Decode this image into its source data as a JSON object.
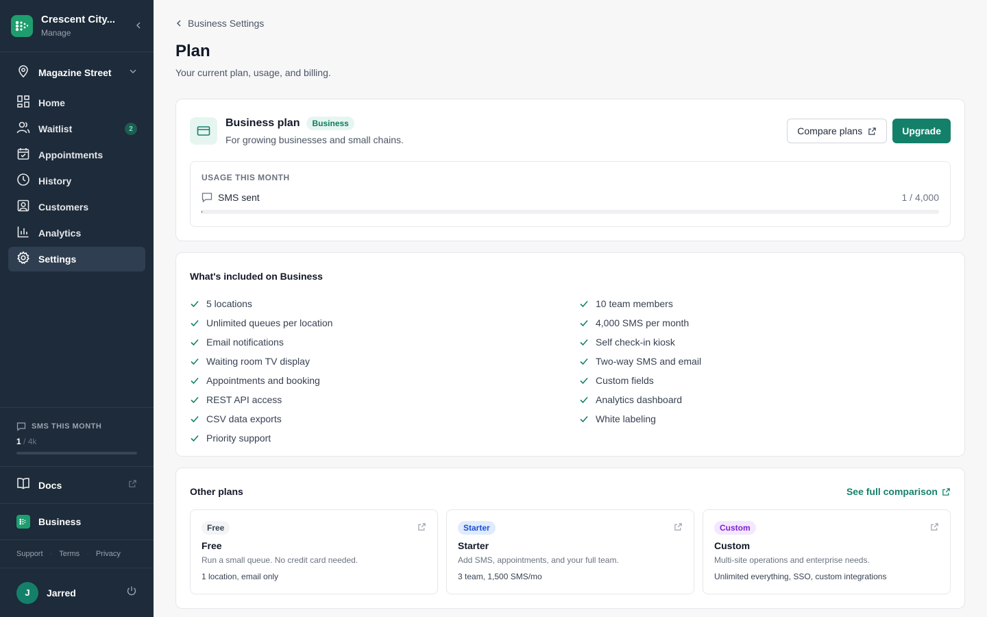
{
  "sidebar": {
    "org_name": "Crescent City...",
    "org_sub": "Manage",
    "location": "Magazine Street",
    "nav": [
      {
        "label": "Home",
        "icon": "grid-icon"
      },
      {
        "label": "Waitlist",
        "icon": "users-icon",
        "badge": "2"
      },
      {
        "label": "Appointments",
        "icon": "calendar-icon"
      },
      {
        "label": "History",
        "icon": "clock-icon"
      },
      {
        "label": "Customers",
        "icon": "contact-icon"
      },
      {
        "label": "Analytics",
        "icon": "bar-chart-icon"
      },
      {
        "label": "Settings",
        "icon": "gear-icon",
        "active": true
      }
    ],
    "sms": {
      "title": "SMS THIS MONTH",
      "used": "1",
      "limit": " / 4k",
      "fraction": 0.00025
    },
    "docs": "Docs",
    "plan": "Business",
    "links": [
      "Support",
      "Terms",
      "Privacy"
    ],
    "user": {
      "initial": "J",
      "name": "Jarred"
    }
  },
  "main": {
    "breadcrumb": "Business Settings",
    "title": "Plan",
    "description": "Your current plan, usage, and billing.",
    "plan": {
      "name": "Business plan",
      "tag": "Business",
      "description": "For growing businesses and small chains.",
      "compare_label": "Compare plans",
      "upgrade_label": "Upgrade"
    },
    "usage": {
      "title": "USAGE THIS MONTH",
      "label": "SMS sent",
      "value": "1 / 4,000",
      "fraction": 0.00025
    },
    "included": {
      "title": "What's included on Business",
      "col1": [
        "5 locations",
        "Unlimited queues per location",
        "Email notifications",
        "Waiting room TV display",
        "Appointments and booking",
        "REST API access",
        "CSV data exports",
        "Priority support"
      ],
      "col2": [
        "10 team members",
        "4,000 SMS per month",
        "Self check-in kiosk",
        "Two-way SMS and email",
        "Custom fields",
        "Analytics dashboard",
        "White labeling"
      ]
    },
    "other": {
      "title": "Other plans",
      "see_full": "See full comparison",
      "plans": [
        {
          "tag": "Free",
          "name": "Free",
          "desc": "Run a small queue. No credit card needed.",
          "detail": "1 location, email only"
        },
        {
          "tag": "Starter",
          "name": "Starter",
          "desc": "Add SMS, appointments, and your full team.",
          "detail": "3 team, 1,500 SMS/mo"
        },
        {
          "tag": "Custom",
          "name": "Custom",
          "desc": "Multi-site operations and enterprise needs.",
          "detail": "Unlimited everything, SSO, custom integrations"
        }
      ]
    }
  },
  "colors": {
    "sidebar": "#1d2b3a",
    "accent": "#14806a",
    "brand": "#1e9e6e"
  }
}
